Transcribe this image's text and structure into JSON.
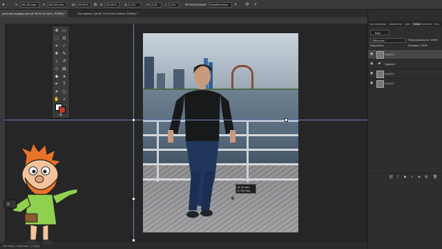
{
  "options_bar": {
    "tool_icon": "move-tool-icon",
    "x_label": "X:",
    "x_value": "461,26 пикс.",
    "y_label": "Y:",
    "y_value": "561,83 пикс.",
    "w_label": "Ш:",
    "w_value": "100,00%",
    "h_label": "В:",
    "h_value": "100,00%",
    "angle_value": "0,00",
    "skew_h": "0,00",
    "skew_v": "0,00",
    "interpolation_label": "Интерполяция:",
    "interpolation_value": "Бикубическая",
    "cancel_icon": "cancel-icon",
    "commit_icon": "checkmark-icon"
  },
  "tabs": [
    {
      "label": "роза фотографии.psd @ 33,3% (Слой 4, RGB/8) *",
      "active": true
    },
    {
      "label": "Без имени-1 @ 66,7% (Слой 4 копия, RGB/8) *",
      "active": false
    }
  ],
  "tools": [
    "move",
    "marquee",
    "lasso",
    "select",
    "crop",
    "eyedropper",
    "healing",
    "brush",
    "stamp",
    "history",
    "eraser",
    "gradient",
    "blur",
    "dodge",
    "pen",
    "type",
    "path",
    "shape",
    "hand",
    "zoom",
    "more"
  ],
  "colors": {
    "foreground": "#ffffff",
    "background": "#c0392b",
    "accent": "#6d86c9"
  },
  "tooltip": {
    "w_line": "Ш: 50 пикс.",
    "h_line": "В: 208 пикс."
  },
  "panel": {
    "tabs": [
      "Гистограмма",
      "Навигатор",
      "Цвет",
      "Слои",
      "Свойства",
      "Кан"
    ],
    "active_tab": "Слои",
    "kind_label": "Вид",
    "blend_mode": "Обычные",
    "opacity_label": "Непрозрачность:",
    "opacity_value": "100%",
    "lock_label": "Закрепить:",
    "fill_label": "Заливка:",
    "fill_value": "100%",
    "layers": [
      {
        "name": "Слой 4",
        "kind": "layer",
        "active": true
      },
      {
        "name": "Группа 1",
        "kind": "group",
        "active": false
      },
      {
        "name": "Слой 3",
        "kind": "layer",
        "active": false
      },
      {
        "name": "Слой 2",
        "kind": "layer",
        "active": false
      }
    ]
  },
  "status_bar": {
    "text": "100 пикс. x 436 пикс. (72 ppi)"
  }
}
